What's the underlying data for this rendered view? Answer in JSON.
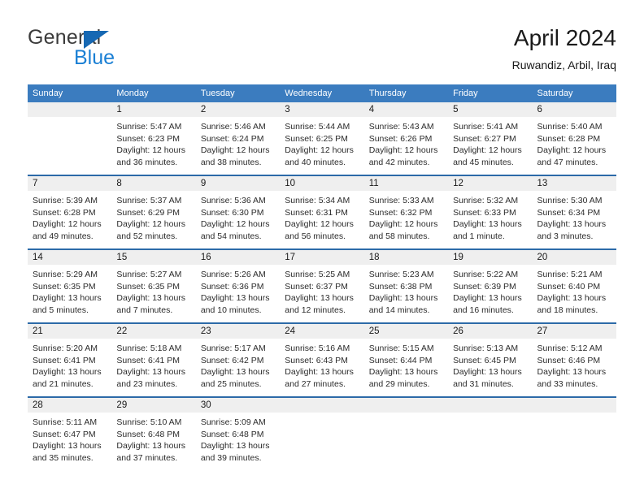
{
  "brand": {
    "name_top": "General",
    "name_bottom": "Blue",
    "accent_color": "#1668b3",
    "blue_text_color": "#1a7fd4"
  },
  "header": {
    "title": "April 2024",
    "subtitle": "Ruwandiz, Arbil, Iraq"
  },
  "theme": {
    "header_row_color": "#3b7cbf",
    "row_separator_color": "#2c6aa8",
    "daynum_band_color": "#efefef",
    "text_color": "#1a1a1a"
  },
  "weekdays": [
    "Sunday",
    "Monday",
    "Tuesday",
    "Wednesday",
    "Thursday",
    "Friday",
    "Saturday"
  ],
  "labels": {
    "sunrise_prefix": "Sunrise:",
    "sunset_prefix": "Sunset:",
    "daylight_prefix": "Daylight:"
  },
  "weeks": [
    [
      {
        "day": "",
        "sunrise": "",
        "sunset": "",
        "daylight_line1": "",
        "daylight_line2": ""
      },
      {
        "day": "1",
        "sunrise": "Sunrise: 5:47 AM",
        "sunset": "Sunset: 6:23 PM",
        "daylight_line1": "Daylight: 12 hours",
        "daylight_line2": "and 36 minutes."
      },
      {
        "day": "2",
        "sunrise": "Sunrise: 5:46 AM",
        "sunset": "Sunset: 6:24 PM",
        "daylight_line1": "Daylight: 12 hours",
        "daylight_line2": "and 38 minutes."
      },
      {
        "day": "3",
        "sunrise": "Sunrise: 5:44 AM",
        "sunset": "Sunset: 6:25 PM",
        "daylight_line1": "Daylight: 12 hours",
        "daylight_line2": "and 40 minutes."
      },
      {
        "day": "4",
        "sunrise": "Sunrise: 5:43 AM",
        "sunset": "Sunset: 6:26 PM",
        "daylight_line1": "Daylight: 12 hours",
        "daylight_line2": "and 42 minutes."
      },
      {
        "day": "5",
        "sunrise": "Sunrise: 5:41 AM",
        "sunset": "Sunset: 6:27 PM",
        "daylight_line1": "Daylight: 12 hours",
        "daylight_line2": "and 45 minutes."
      },
      {
        "day": "6",
        "sunrise": "Sunrise: 5:40 AM",
        "sunset": "Sunset: 6:28 PM",
        "daylight_line1": "Daylight: 12 hours",
        "daylight_line2": "and 47 minutes."
      }
    ],
    [
      {
        "day": "7",
        "sunrise": "Sunrise: 5:39 AM",
        "sunset": "Sunset: 6:28 PM",
        "daylight_line1": "Daylight: 12 hours",
        "daylight_line2": "and 49 minutes."
      },
      {
        "day": "8",
        "sunrise": "Sunrise: 5:37 AM",
        "sunset": "Sunset: 6:29 PM",
        "daylight_line1": "Daylight: 12 hours",
        "daylight_line2": "and 52 minutes."
      },
      {
        "day": "9",
        "sunrise": "Sunrise: 5:36 AM",
        "sunset": "Sunset: 6:30 PM",
        "daylight_line1": "Daylight: 12 hours",
        "daylight_line2": "and 54 minutes."
      },
      {
        "day": "10",
        "sunrise": "Sunrise: 5:34 AM",
        "sunset": "Sunset: 6:31 PM",
        "daylight_line1": "Daylight: 12 hours",
        "daylight_line2": "and 56 minutes."
      },
      {
        "day": "11",
        "sunrise": "Sunrise: 5:33 AM",
        "sunset": "Sunset: 6:32 PM",
        "daylight_line1": "Daylight: 12 hours",
        "daylight_line2": "and 58 minutes."
      },
      {
        "day": "12",
        "sunrise": "Sunrise: 5:32 AM",
        "sunset": "Sunset: 6:33 PM",
        "daylight_line1": "Daylight: 13 hours",
        "daylight_line2": "and 1 minute."
      },
      {
        "day": "13",
        "sunrise": "Sunrise: 5:30 AM",
        "sunset": "Sunset: 6:34 PM",
        "daylight_line1": "Daylight: 13 hours",
        "daylight_line2": "and 3 minutes."
      }
    ],
    [
      {
        "day": "14",
        "sunrise": "Sunrise: 5:29 AM",
        "sunset": "Sunset: 6:35 PM",
        "daylight_line1": "Daylight: 13 hours",
        "daylight_line2": "and 5 minutes."
      },
      {
        "day": "15",
        "sunrise": "Sunrise: 5:27 AM",
        "sunset": "Sunset: 6:35 PM",
        "daylight_line1": "Daylight: 13 hours",
        "daylight_line2": "and 7 minutes."
      },
      {
        "day": "16",
        "sunrise": "Sunrise: 5:26 AM",
        "sunset": "Sunset: 6:36 PM",
        "daylight_line1": "Daylight: 13 hours",
        "daylight_line2": "and 10 minutes."
      },
      {
        "day": "17",
        "sunrise": "Sunrise: 5:25 AM",
        "sunset": "Sunset: 6:37 PM",
        "daylight_line1": "Daylight: 13 hours",
        "daylight_line2": "and 12 minutes."
      },
      {
        "day": "18",
        "sunrise": "Sunrise: 5:23 AM",
        "sunset": "Sunset: 6:38 PM",
        "daylight_line1": "Daylight: 13 hours",
        "daylight_line2": "and 14 minutes."
      },
      {
        "day": "19",
        "sunrise": "Sunrise: 5:22 AM",
        "sunset": "Sunset: 6:39 PM",
        "daylight_line1": "Daylight: 13 hours",
        "daylight_line2": "and 16 minutes."
      },
      {
        "day": "20",
        "sunrise": "Sunrise: 5:21 AM",
        "sunset": "Sunset: 6:40 PM",
        "daylight_line1": "Daylight: 13 hours",
        "daylight_line2": "and 18 minutes."
      }
    ],
    [
      {
        "day": "21",
        "sunrise": "Sunrise: 5:20 AM",
        "sunset": "Sunset: 6:41 PM",
        "daylight_line1": "Daylight: 13 hours",
        "daylight_line2": "and 21 minutes."
      },
      {
        "day": "22",
        "sunrise": "Sunrise: 5:18 AM",
        "sunset": "Sunset: 6:41 PM",
        "daylight_line1": "Daylight: 13 hours",
        "daylight_line2": "and 23 minutes."
      },
      {
        "day": "23",
        "sunrise": "Sunrise: 5:17 AM",
        "sunset": "Sunset: 6:42 PM",
        "daylight_line1": "Daylight: 13 hours",
        "daylight_line2": "and 25 minutes."
      },
      {
        "day": "24",
        "sunrise": "Sunrise: 5:16 AM",
        "sunset": "Sunset: 6:43 PM",
        "daylight_line1": "Daylight: 13 hours",
        "daylight_line2": "and 27 minutes."
      },
      {
        "day": "25",
        "sunrise": "Sunrise: 5:15 AM",
        "sunset": "Sunset: 6:44 PM",
        "daylight_line1": "Daylight: 13 hours",
        "daylight_line2": "and 29 minutes."
      },
      {
        "day": "26",
        "sunrise": "Sunrise: 5:13 AM",
        "sunset": "Sunset: 6:45 PM",
        "daylight_line1": "Daylight: 13 hours",
        "daylight_line2": "and 31 minutes."
      },
      {
        "day": "27",
        "sunrise": "Sunrise: 5:12 AM",
        "sunset": "Sunset: 6:46 PM",
        "daylight_line1": "Daylight: 13 hours",
        "daylight_line2": "and 33 minutes."
      }
    ],
    [
      {
        "day": "28",
        "sunrise": "Sunrise: 5:11 AM",
        "sunset": "Sunset: 6:47 PM",
        "daylight_line1": "Daylight: 13 hours",
        "daylight_line2": "and 35 minutes."
      },
      {
        "day": "29",
        "sunrise": "Sunrise: 5:10 AM",
        "sunset": "Sunset: 6:48 PM",
        "daylight_line1": "Daylight: 13 hours",
        "daylight_line2": "and 37 minutes."
      },
      {
        "day": "30",
        "sunrise": "Sunrise: 5:09 AM",
        "sunset": "Sunset: 6:48 PM",
        "daylight_line1": "Daylight: 13 hours",
        "daylight_line2": "and 39 minutes."
      },
      {
        "day": "",
        "sunrise": "",
        "sunset": "",
        "daylight_line1": "",
        "daylight_line2": ""
      },
      {
        "day": "",
        "sunrise": "",
        "sunset": "",
        "daylight_line1": "",
        "daylight_line2": ""
      },
      {
        "day": "",
        "sunrise": "",
        "sunset": "",
        "daylight_line1": "",
        "daylight_line2": ""
      },
      {
        "day": "",
        "sunrise": "",
        "sunset": "",
        "daylight_line1": "",
        "daylight_line2": ""
      }
    ]
  ]
}
